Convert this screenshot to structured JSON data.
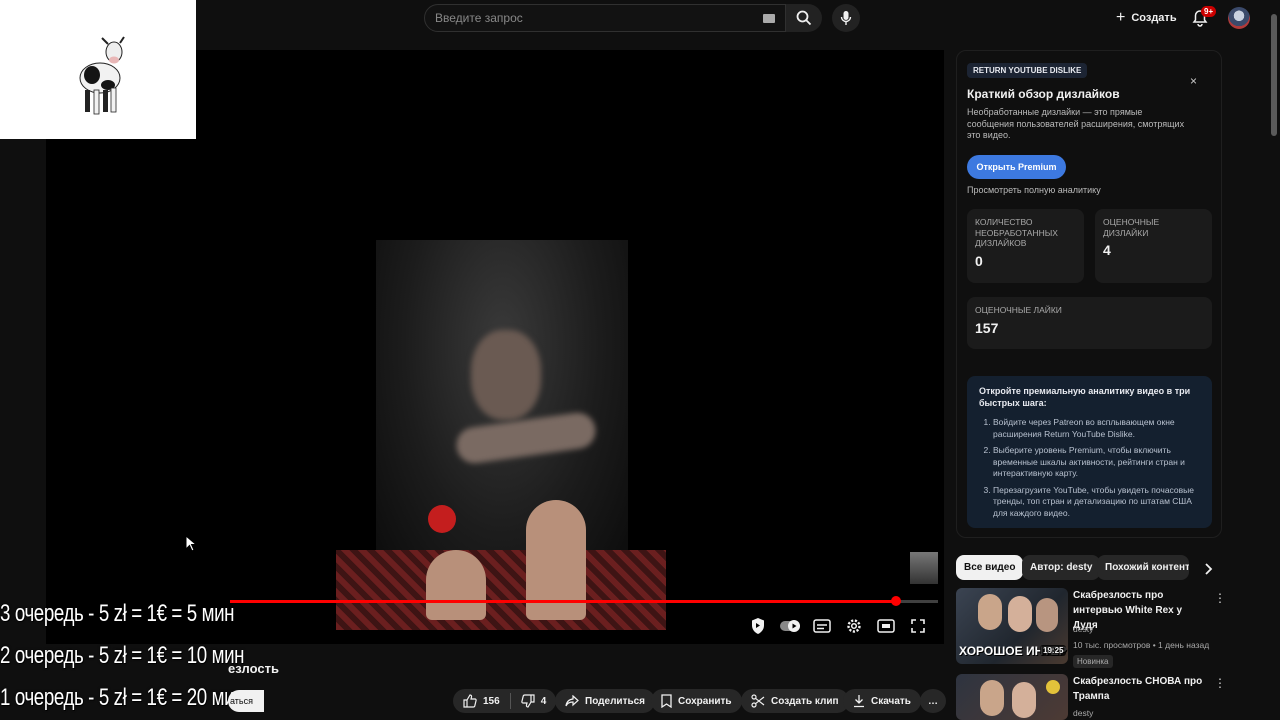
{
  "header": {
    "search_placeholder": "Введите запрос",
    "create_label": "Создать",
    "notifications_badge": "9+"
  },
  "player": {
    "progress": 0.94,
    "watched": 0.0,
    "colors": {
      "progress": "#ff0000"
    }
  },
  "overlay": {
    "queue": [
      "3 очередь - 5 zł = 1€ = 5 мин",
      "2 очередь - 5 zł = 1€ = 10 мин",
      "1 очередь - 5 zł = 1€ = 20 мин"
    ],
    "title_fragment": "езлость",
    "subscribe_fragment": "аться"
  },
  "actions": {
    "likes": "156",
    "dislikes": "4",
    "share": "Поделиться",
    "save": "Сохранить",
    "clip": "Создать клип",
    "download": "Скачать",
    "more": "…"
  },
  "ryd": {
    "tag": "RETURN YOUTUBE DISLIKE",
    "close": "×",
    "title": "Краткий обзор дизлайков",
    "description": "Необработанные дизлайки — это прямые сообщения пользователей расширения, смотрящих это видео.",
    "premium_button": "Открыть Premium",
    "analytics_link": "Просмотреть полную аналитику",
    "stats": [
      {
        "label": "Количество необработанных дизлайков",
        "value": "0"
      },
      {
        "label": "Оценочные дизлайки",
        "value": "4"
      },
      {
        "label": "Оценочные лайки",
        "value": "157"
      }
    ],
    "promo": {
      "heading": "Откройте премиальную аналитику видео в три быстрых шага:",
      "steps": [
        "Войдите через Patreon во всплывающем окне расширения Return YouTube Dislike.",
        "Выберите уровень Premium, чтобы включить временные шкалы активности, рейтинги стран и интерактивную карту.",
        "Перезагрузите YouTube, чтобы увидеть почасовые тренды, топ стран и детализацию по штатам США для каждого видео."
      ]
    }
  },
  "chips": [
    "Все видео",
    "Автор: desty",
    "Похожий контент"
  ],
  "recommendations": [
    {
      "title": "Скабрезлость про интервью White Rex у Дудя",
      "channel": "desty",
      "meta": "10 тыс. просмотров • 1 день назад",
      "badge": "Новинка",
      "duration": "19:25",
      "thumb_caption": "ХОРОШОЕ ИНТЕР"
    },
    {
      "title": "Скабрезлость СНОВА про Трампа",
      "channel": "desty"
    }
  ]
}
